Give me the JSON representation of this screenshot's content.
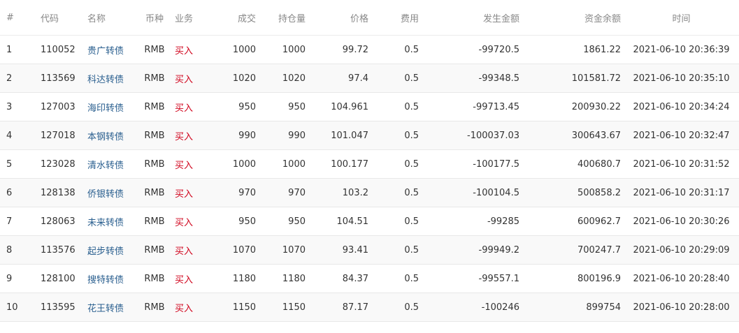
{
  "headers": {
    "idx": "#",
    "code": "代码",
    "name": "名称",
    "currency": "币种",
    "business": "业务",
    "deal": "成交",
    "position": "持仓量",
    "price": "价格",
    "fee": "费用",
    "amount": "发生金额",
    "balance": "资金余额",
    "time": "时间"
  },
  "colors": {
    "link": "#2a5f8f",
    "buy": "#d0021b"
  },
  "rows": [
    {
      "idx": "1",
      "code": "110052",
      "name": "贵广转债",
      "currency": "RMB",
      "business": "买入",
      "deal": "1000",
      "position": "1000",
      "price": "99.72",
      "fee": "0.5",
      "amount": "-99720.5",
      "balance": "1861.22",
      "time": "2021-06-10 20:36:39"
    },
    {
      "idx": "2",
      "code": "113569",
      "name": "科达转债",
      "currency": "RMB",
      "business": "买入",
      "deal": "1020",
      "position": "1020",
      "price": "97.4",
      "fee": "0.5",
      "amount": "-99348.5",
      "balance": "101581.72",
      "time": "2021-06-10 20:35:10"
    },
    {
      "idx": "3",
      "code": "127003",
      "name": "海印转债",
      "currency": "RMB",
      "business": "买入",
      "deal": "950",
      "position": "950",
      "price": "104.961",
      "fee": "0.5",
      "amount": "-99713.45",
      "balance": "200930.22",
      "time": "2021-06-10 20:34:24"
    },
    {
      "idx": "4",
      "code": "127018",
      "name": "本钢转债",
      "currency": "RMB",
      "business": "买入",
      "deal": "990",
      "position": "990",
      "price": "101.047",
      "fee": "0.5",
      "amount": "-100037.03",
      "balance": "300643.67",
      "time": "2021-06-10 20:32:47"
    },
    {
      "idx": "5",
      "code": "123028",
      "name": "清水转债",
      "currency": "RMB",
      "business": "买入",
      "deal": "1000",
      "position": "1000",
      "price": "100.177",
      "fee": "0.5",
      "amount": "-100177.5",
      "balance": "400680.7",
      "time": "2021-06-10 20:31:52"
    },
    {
      "idx": "6",
      "code": "128138",
      "name": "侨银转债",
      "currency": "RMB",
      "business": "买入",
      "deal": "970",
      "position": "970",
      "price": "103.2",
      "fee": "0.5",
      "amount": "-100104.5",
      "balance": "500858.2",
      "time": "2021-06-10 20:31:17"
    },
    {
      "idx": "7",
      "code": "128063",
      "name": "未来转债",
      "currency": "RMB",
      "business": "买入",
      "deal": "950",
      "position": "950",
      "price": "104.51",
      "fee": "0.5",
      "amount": "-99285",
      "balance": "600962.7",
      "time": "2021-06-10 20:30:26"
    },
    {
      "idx": "8",
      "code": "113576",
      "name": "起步转债",
      "currency": "RMB",
      "business": "买入",
      "deal": "1070",
      "position": "1070",
      "price": "93.41",
      "fee": "0.5",
      "amount": "-99949.2",
      "balance": "700247.7",
      "time": "2021-06-10 20:29:09"
    },
    {
      "idx": "9",
      "code": "128100",
      "name": "搜特转债",
      "currency": "RMB",
      "business": "买入",
      "deal": "1180",
      "position": "1180",
      "price": "84.37",
      "fee": "0.5",
      "amount": "-99557.1",
      "balance": "800196.9",
      "time": "2021-06-10 20:28:40"
    },
    {
      "idx": "10",
      "code": "113595",
      "name": "花王转债",
      "currency": "RMB",
      "business": "买入",
      "deal": "1150",
      "position": "1150",
      "price": "87.17",
      "fee": "0.5",
      "amount": "-100246",
      "balance": "899754",
      "time": "2021-06-10 20:28:00"
    }
  ]
}
